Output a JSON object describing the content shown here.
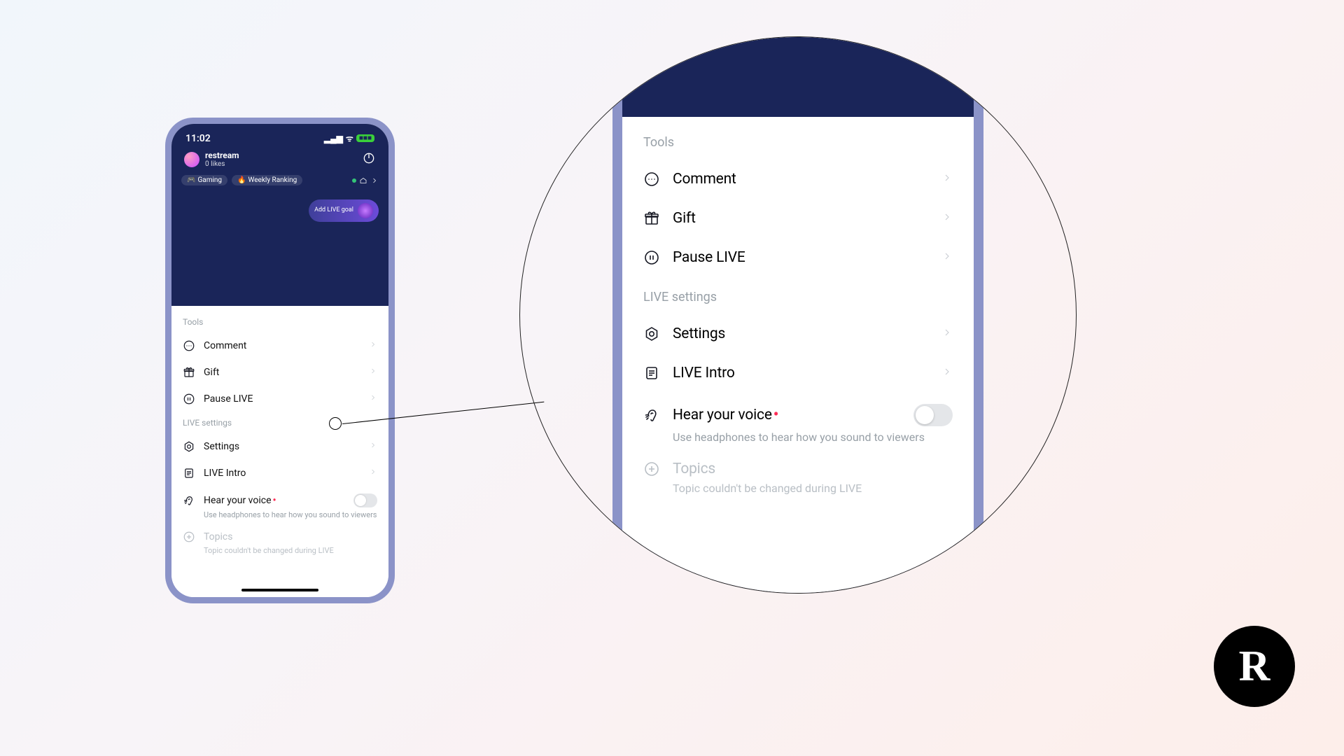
{
  "statusbar": {
    "time": "11:02",
    "battery": "■■■"
  },
  "user": {
    "name": "restream",
    "likes": "0 likes"
  },
  "tags": {
    "gaming": "Gaming",
    "ranking": "Weekly Ranking"
  },
  "goal": {
    "label": "Add LIVE goal"
  },
  "sections": {
    "tools": "Tools",
    "live_settings": "LIVE settings"
  },
  "rows": {
    "comment": "Comment",
    "gift": "Gift",
    "pause": "Pause LIVE",
    "settings": "Settings",
    "intro": "LIVE Intro",
    "hear": "Hear your voice",
    "hear_sub": "Use headphones to hear how you sound to viewers",
    "topics": "Topics",
    "topics_sub": "Topic couldn't be changed during LIVE"
  },
  "brand": {
    "letter": "R"
  }
}
